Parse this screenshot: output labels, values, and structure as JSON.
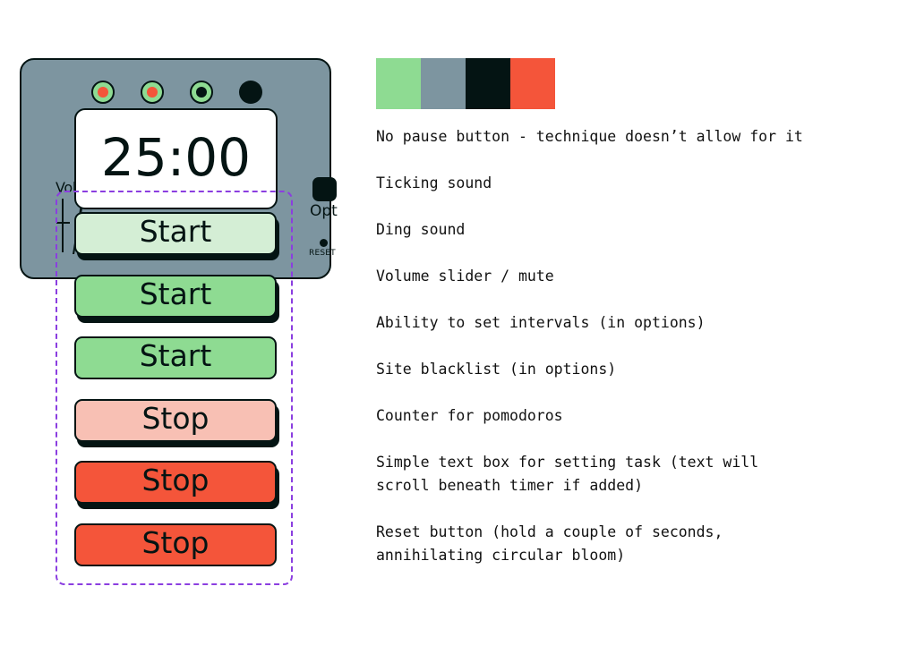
{
  "device": {
    "leds": [
      {
        "name": "led-indicator-1",
        "ring_color": "#8edb92",
        "core_color": "#f4553a"
      },
      {
        "name": "led-indicator-2",
        "ring_color": "#8edb92",
        "core_color": "#f4553a"
      },
      {
        "name": "led-indicator-3",
        "ring_color": "#8edb92",
        "core_color": "#041413"
      }
    ],
    "speaker_color": "#041413",
    "volume_label": "Vol",
    "timer_value": "25:00",
    "options_label": "Opt",
    "reset_label": "RESET"
  },
  "button_states": [
    {
      "label": "Start",
      "state": "hover",
      "fill": "#d4eed5",
      "shadow": true
    },
    {
      "label": "Start",
      "state": "normal",
      "fill": "#8edb92",
      "shadow": true
    },
    {
      "label": "Start",
      "state": "pressed",
      "fill": "#8edb92",
      "shadow": false
    },
    {
      "label": "Stop",
      "state": "hover",
      "fill": "#f8c0b4",
      "shadow": true
    },
    {
      "label": "Stop",
      "state": "normal",
      "fill": "#f4553a",
      "shadow": true
    },
    {
      "label": "Stop",
      "state": "pressed",
      "fill": "#f4553a",
      "shadow": false
    }
  ],
  "palette": [
    {
      "name": "green",
      "hex": "#8edb92"
    },
    {
      "name": "slate",
      "hex": "#7d95a0"
    },
    {
      "name": "near-black",
      "hex": "#041413"
    },
    {
      "name": "red-orange",
      "hex": "#f4553a"
    }
  ],
  "notes": [
    "No pause button - technique doesn’t allow for it",
    "Ticking sound",
    "Ding sound",
    "Volume slider / mute",
    "Ability to set intervals (in options)",
    "Site blacklist (in options)",
    "Counter for pomodoros",
    "Simple text box for setting task (text will\nscroll beneath timer if added)",
    "Reset button (hold a couple of seconds,\nannihilating circular bloom)"
  ]
}
